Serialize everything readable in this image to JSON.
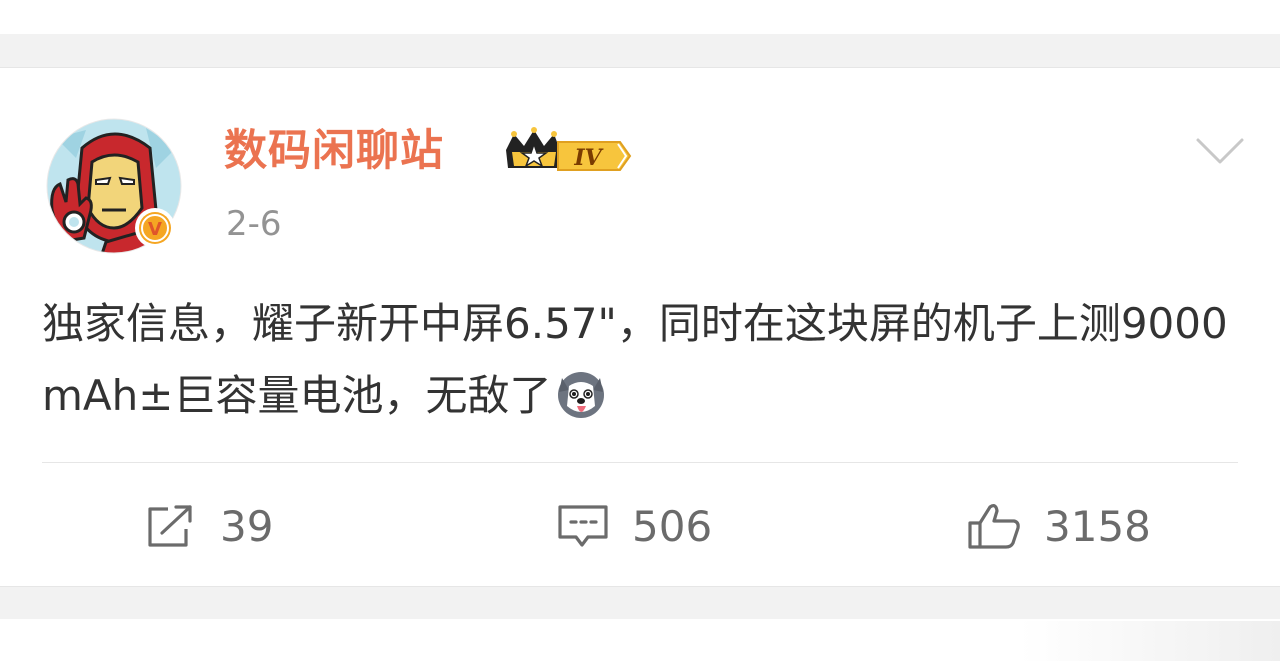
{
  "user": {
    "name": "数码闲聊站",
    "level_badge_text": "IV",
    "verified_badge_text": "V"
  },
  "post": {
    "time": "2-6",
    "text": "独家信息，耀子新开中屏6.57\"，同时在这块屏的机子上测9000mAh±巨容量电池，无敌了",
    "emoji": "husky-dog-emoji"
  },
  "actions": {
    "repost_count": "39",
    "comment_count": "506",
    "like_count": "3158"
  },
  "colors": {
    "username": "#eb7350",
    "timestamp": "#939393",
    "body_text": "#333333",
    "count_text": "#6b6b6b",
    "background": "#f2f2f2",
    "card": "#ffffff",
    "verified_badge": "#f5a623"
  }
}
